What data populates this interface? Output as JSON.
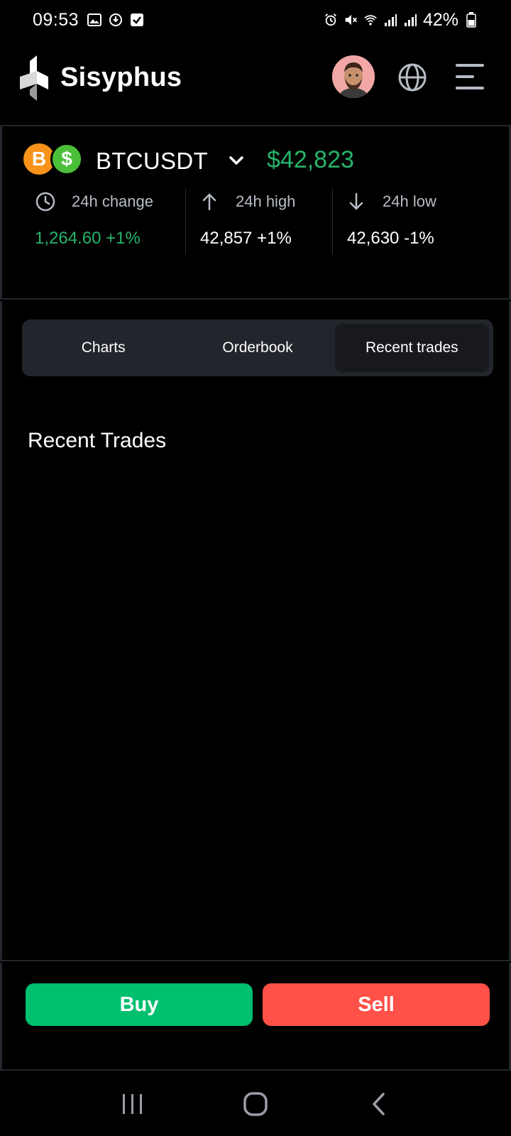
{
  "status_bar": {
    "time": "09:53",
    "battery": "42%"
  },
  "header": {
    "app_name": "Sisyphus"
  },
  "ticker": {
    "base_coin_symbol": "B",
    "quote_coin_symbol": "$",
    "pair": "BTCUSDT",
    "price": "$42,823",
    "stats": [
      {
        "label": "24h change",
        "value": "1,264.60 +1%"
      },
      {
        "label": "24h high",
        "value": "42,857 +1%"
      },
      {
        "label": "24h low",
        "value": "42,630 -1%"
      }
    ]
  },
  "tabs": [
    {
      "label": "Charts",
      "active": false
    },
    {
      "label": "Orderbook",
      "active": false
    },
    {
      "label": "Recent trades",
      "active": true
    }
  ],
  "main": {
    "section_title": "Recent Trades"
  },
  "actions": {
    "buy_label": "Buy",
    "sell_label": "Sell"
  },
  "colors": {
    "positive": "#26b46b",
    "buy": "#00bf6f",
    "sell": "#ff5148",
    "tab_bg": "#22252b"
  }
}
